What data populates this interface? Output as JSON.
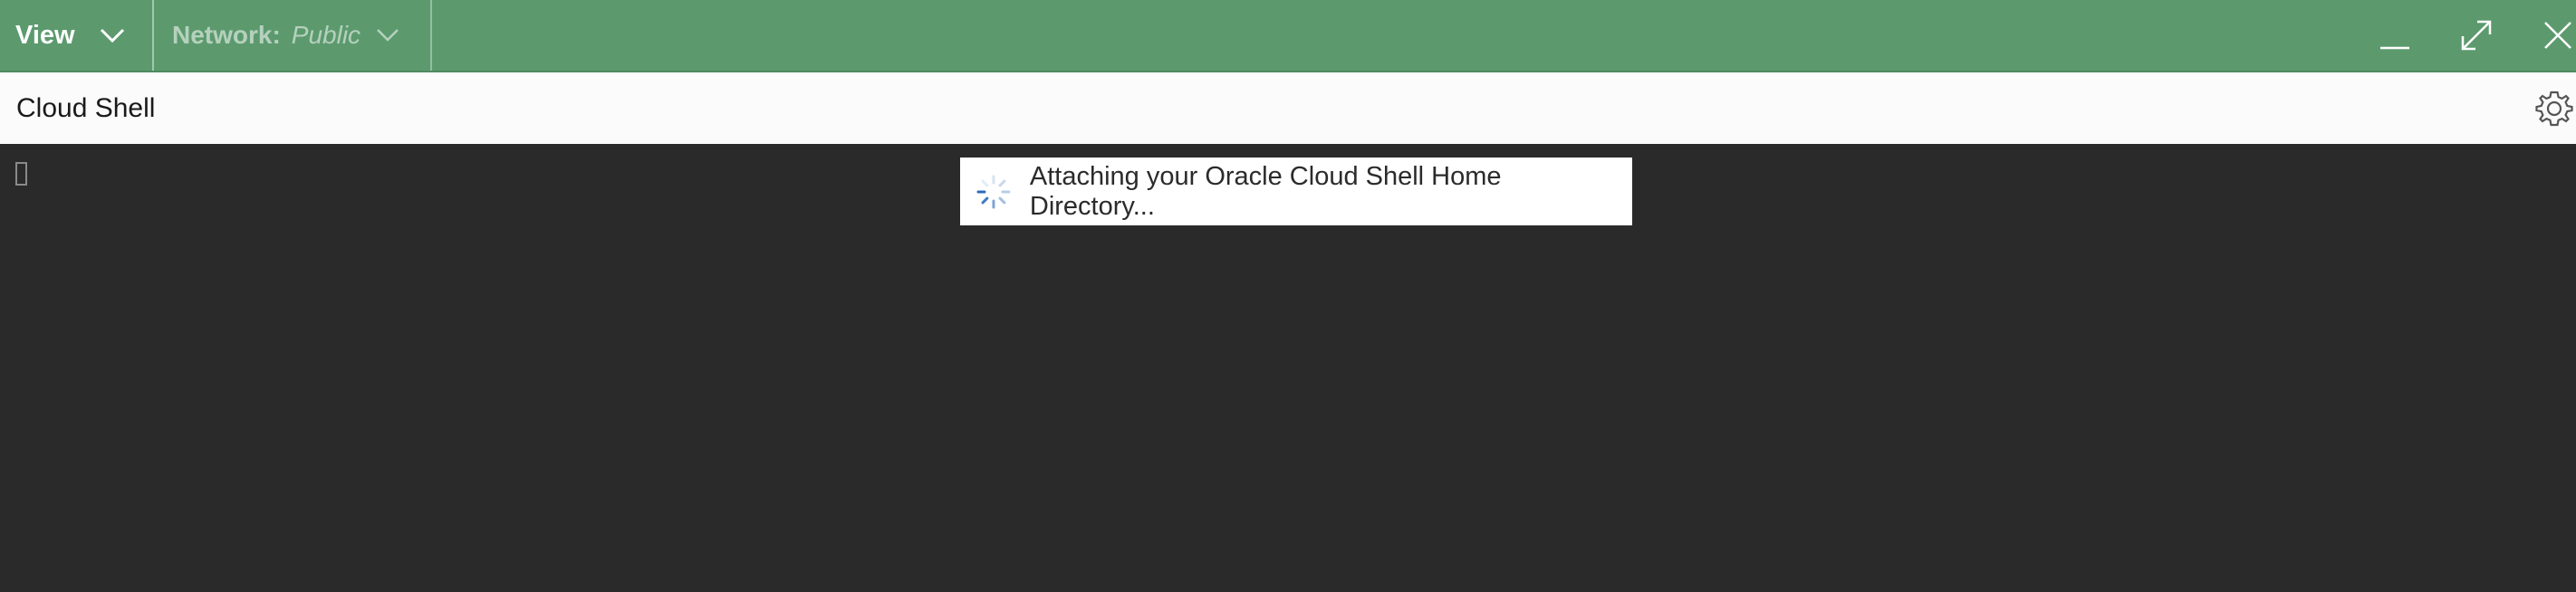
{
  "toolbar": {
    "view_label": "View",
    "network_label": "Network:",
    "network_value": "Public"
  },
  "window_controls": {
    "icons": [
      "minimize-icon",
      "maximize-icon",
      "close-icon"
    ]
  },
  "titlebar": {
    "title": "Cloud Shell",
    "settings_icon": "gear-icon"
  },
  "terminal": {
    "status_message": "Attaching your Oracle Cloud Shell Home Directory..."
  },
  "colors": {
    "toolbar_bg": "#5c9a6e",
    "titlebar_bg": "#fbfbfb",
    "terminal_bg": "#2a2a2a",
    "toast_bg": "#ffffff",
    "spinner": "#3f7cc4"
  }
}
